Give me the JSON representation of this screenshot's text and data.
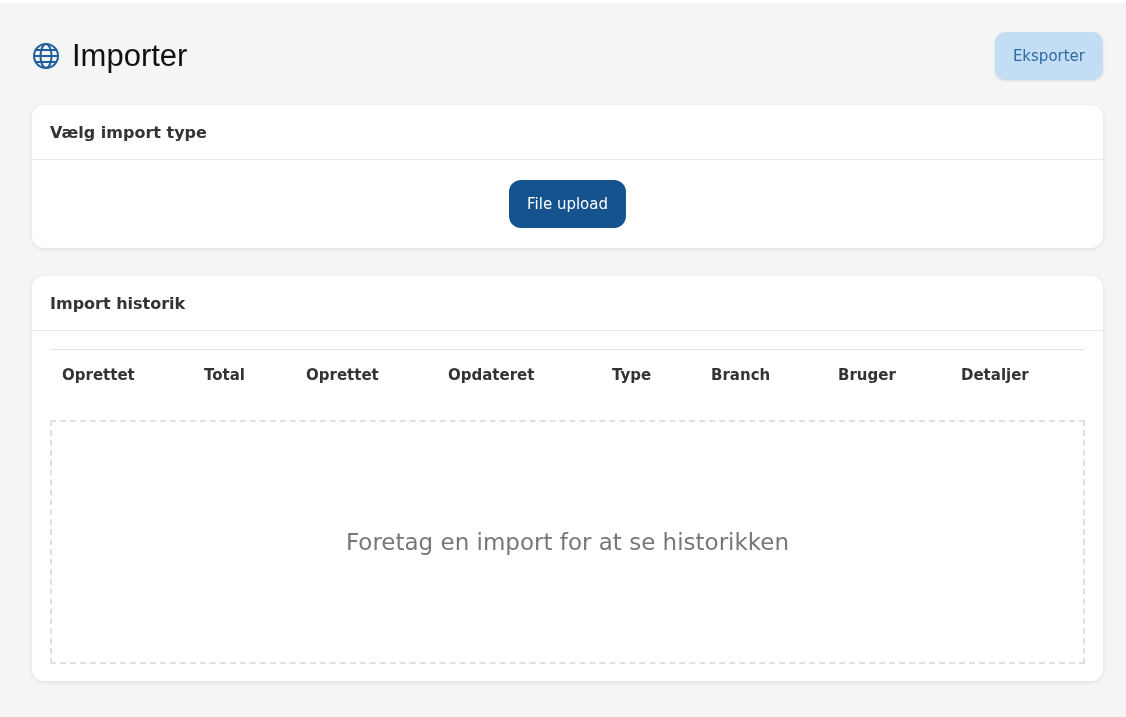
{
  "page": {
    "title": "Importer",
    "export_button": "Eksporter"
  },
  "import_type": {
    "title": "Vælg import type",
    "buttons": [
      "File upload"
    ]
  },
  "history": {
    "title": "Import historik",
    "columns": [
      "Oprettet",
      "Total",
      "Oprettet",
      "Opdateret",
      "Type",
      "Branch",
      "Bruger",
      "Detaljer"
    ],
    "empty_message": "Foretag en import for at se historikken"
  }
}
